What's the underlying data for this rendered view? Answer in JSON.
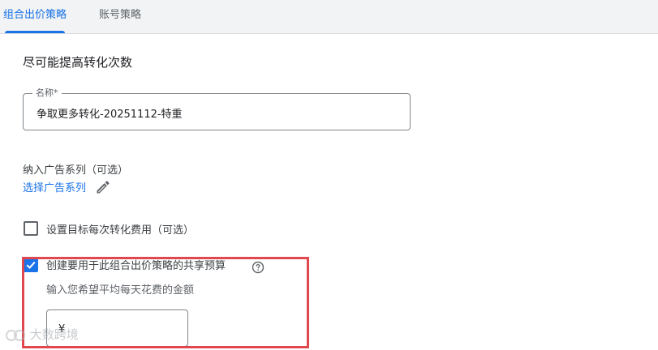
{
  "tabs": [
    {
      "label": "组合出价策略",
      "active": true
    },
    {
      "label": "账号策略",
      "active": false
    }
  ],
  "page_title": "尽可能提高转化次数",
  "name_field": {
    "label": "名称*",
    "value": "争取更多转化-20251112-特重"
  },
  "campaigns": {
    "label": "纳入广告系列（可选）",
    "link": "选择广告系列",
    "icon": "pencil-edit-icon"
  },
  "target_cpa": {
    "label": "设置目标每次转化费用（可选）",
    "checked": false
  },
  "shared_budget": {
    "label": "创建要用于此组合出价策略的共享预算",
    "checked": true,
    "help_icon": "help-circle-icon",
    "hint": "输入您希望平均每天花费的金额",
    "currency": "¥",
    "value": ""
  },
  "highlight_color": "#e0474f",
  "accent_color": "#1a73e8",
  "watermark": {
    "text": "大数跨境",
    "icon": "watermark-logo-icon"
  }
}
